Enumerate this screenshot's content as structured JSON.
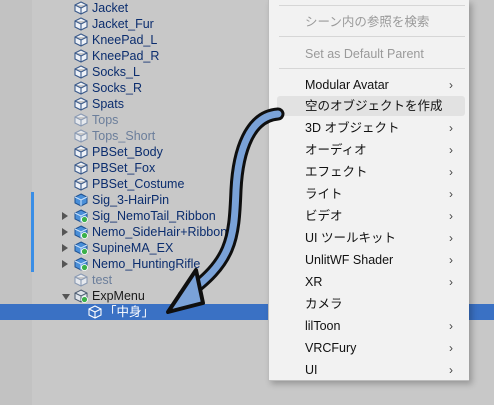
{
  "hierarchy": {
    "rows": [
      {
        "label": "Jacket",
        "dim": false
      },
      {
        "label": "Jacket_Fur",
        "dim": false
      },
      {
        "label": "KneePad_L",
        "dim": false
      },
      {
        "label": "KneePad_R",
        "dim": false
      },
      {
        "label": "Socks_L",
        "dim": false
      },
      {
        "label": "Socks_R",
        "dim": false
      },
      {
        "label": "Spats",
        "dim": false
      },
      {
        "label": "Tops",
        "dim": true
      },
      {
        "label": "Tops_Short",
        "dim": true
      },
      {
        "label": "PBSet_Body",
        "dim": false
      },
      {
        "label": "PBSet_Fox",
        "dim": false
      },
      {
        "label": "PBSet_Costume",
        "dim": false
      },
      {
        "label": "Sig_3-HairPin",
        "dim": false
      },
      {
        "label": "Sig_NemoTail_Ribbon",
        "dim": false
      },
      {
        "label": "Nemo_SideHair+Ribbon",
        "dim": false
      },
      {
        "label": "SupineMA_EX",
        "dim": false
      },
      {
        "label": "Nemo_HuntingRifle",
        "dim": false
      },
      {
        "label": "test",
        "dim": true
      },
      {
        "label": "ExpMenu",
        "dim": false
      },
      {
        "label": "「中身」",
        "dim": false
      }
    ]
  },
  "context_menu": {
    "top_item": "",
    "items": [
      {
        "label": "シーン内の参照を検索",
        "disabled": true,
        "submenu": false
      },
      {
        "label": "Set as Default Parent",
        "disabled": true,
        "submenu": false
      },
      {
        "label": "Modular Avatar",
        "disabled": false,
        "submenu": true
      },
      {
        "label": "空のオブジェクトを作成",
        "disabled": false,
        "submenu": false
      },
      {
        "label": "3D オブジェクト",
        "disabled": false,
        "submenu": true
      },
      {
        "label": "オーディオ",
        "disabled": false,
        "submenu": true
      },
      {
        "label": "エフェクト",
        "disabled": false,
        "submenu": true
      },
      {
        "label": "ライト",
        "disabled": false,
        "submenu": true
      },
      {
        "label": "ビデオ",
        "disabled": false,
        "submenu": true
      },
      {
        "label": "UI ツールキット",
        "disabled": false,
        "submenu": true
      },
      {
        "label": "UnlitWF Shader",
        "disabled": false,
        "submenu": true
      },
      {
        "label": "XR",
        "disabled": false,
        "submenu": true
      },
      {
        "label": "カメラ",
        "disabled": false,
        "submenu": false
      },
      {
        "label": "lilToon",
        "disabled": false,
        "submenu": true
      },
      {
        "label": "VRCFury",
        "disabled": false,
        "submenu": true
      },
      {
        "label": "UI",
        "disabled": false,
        "submenu": true
      }
    ],
    "chevron": "›"
  },
  "colors": {
    "selection": "#3a71c4",
    "text": "#0b2d6e",
    "annotation_arrow": "#7aa2d8"
  }
}
